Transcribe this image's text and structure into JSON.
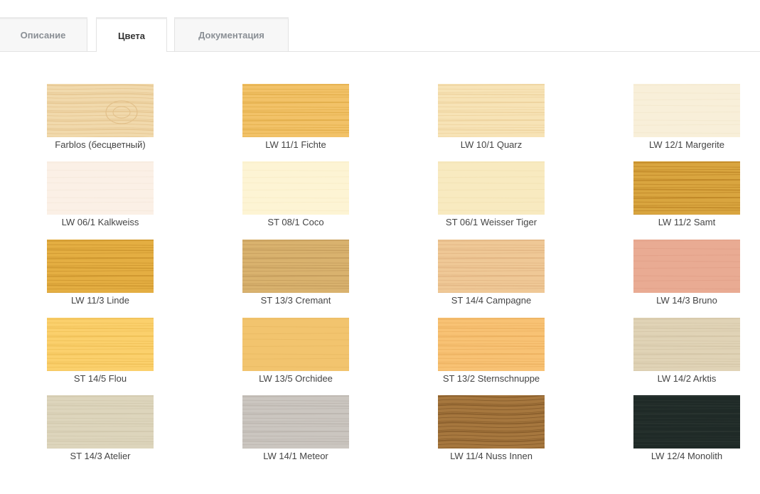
{
  "tabs": [
    {
      "label": "Описание",
      "active": false
    },
    {
      "label": "Цвета",
      "active": true
    },
    {
      "label": "Документация",
      "active": false
    }
  ],
  "swatches": [
    {
      "label": "Farblos (бесцветный)",
      "base": "#f1d9ac",
      "stripe": "#e2c08a",
      "grain": "knot"
    },
    {
      "label": "LW 11/1 Fichte",
      "base": "#f2c268",
      "stripe": "#dfa944",
      "grain": "lines"
    },
    {
      "label": "LW 10/1 Quarz",
      "base": "#f7e3b6",
      "stripe": "#ebcf98",
      "grain": "lines"
    },
    {
      "label": "LW 12/1 Margerite",
      "base": "#f8efd9",
      "stripe": "#efe3c5",
      "grain": "soft"
    },
    {
      "label": "LW 06/1 Kalkweiss",
      "base": "#fbf0e6",
      "stripe": "#f2e3d4",
      "grain": "soft"
    },
    {
      "label": "ST 08/1 Coco",
      "base": "#fdf4d4",
      "stripe": "#f5e8bd",
      "grain": "soft"
    },
    {
      "label": "ST 06/1 Weisser Tiger",
      "base": "#f8eac0",
      "stripe": "#eedca9",
      "grain": "soft"
    },
    {
      "label": "LW 11/2 Samt",
      "base": "#d9a53f",
      "stripe": "#b98223",
      "grain": "lines"
    },
    {
      "label": "LW 11/3 Linde",
      "base": "#e4ae42",
      "stripe": "#c8902b",
      "grain": "lines"
    },
    {
      "label": "ST 13/3 Cremant",
      "base": "#d9b26e",
      "stripe": "#c0985a",
      "grain": "lines"
    },
    {
      "label": "ST 14/4 Campagne",
      "base": "#efc896",
      "stripe": "#dfb27f",
      "grain": "lines"
    },
    {
      "label": "LW 14/3 Bruno",
      "base": "#e9ab93",
      "stripe": "#dd9a82",
      "grain": "soft"
    },
    {
      "label": "ST 14/5 Flou",
      "base": "#fbd06c",
      "stripe": "#ecbc52",
      "grain": "lines"
    },
    {
      "label": "LW 13/5 Orchidee",
      "base": "#f2c46e",
      "stripe": "#e4b35c",
      "grain": "soft"
    },
    {
      "label": "ST 13/2 Sternschnuppe",
      "base": "#f8c274",
      "stripe": "#eaae5c",
      "grain": "lines"
    },
    {
      "label": "LW 14/2 Arktis",
      "base": "#e0d3b6",
      "stripe": "#d1c3a4",
      "grain": "lines"
    },
    {
      "label": "ST 14/3 Atelier",
      "base": "#ddd5bc",
      "stripe": "#cfc6ab",
      "grain": "lines"
    },
    {
      "label": "LW 14/1 Meteor",
      "base": "#cbc6c0",
      "stripe": "#b8b2ab",
      "grain": "lines"
    },
    {
      "label": "LW 11/4 Nuss Innen",
      "base": "#a6773e",
      "stripe": "#7d5426",
      "grain": "wave"
    },
    {
      "label": "LW 12/4 Monolith",
      "base": "#1f2a27",
      "stripe": "#2c3733",
      "grain": "lines"
    }
  ]
}
